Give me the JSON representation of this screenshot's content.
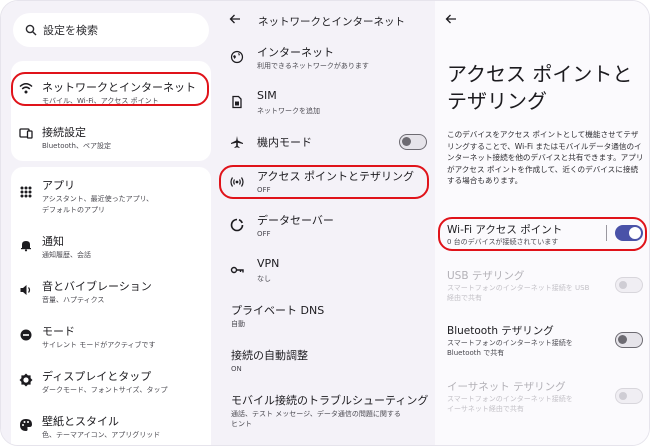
{
  "colors": {
    "highlight": "#e0131a",
    "accent": "#4a52a8"
  },
  "search": {
    "placeholder": "設定を検索"
  },
  "sidebar": {
    "items": [
      {
        "icon": "wifi-icon",
        "title": "ネットワークとインターネット",
        "subtitle": "モバイル、Wi-Fi、アクセス ポイント"
      },
      {
        "icon": "devices-icon",
        "title": "接続設定",
        "subtitle": "Bluetooth、ペア設定"
      },
      {
        "icon": "apps-icon",
        "title": "アプリ",
        "subtitle": "アシスタント、最近使ったアプリ、デフォルトのアプリ"
      },
      {
        "icon": "bell-icon",
        "title": "通知",
        "subtitle": "通知履歴、会話"
      },
      {
        "icon": "volume-icon",
        "title": "音とバイブレーション",
        "subtitle": "音量、ハプティクス"
      },
      {
        "icon": "mode-icon",
        "title": "モード",
        "subtitle": "サイレント モードがアクティブです"
      },
      {
        "icon": "brightness-icon",
        "title": "ディスプレイとタップ",
        "subtitle": "ダークモード、フォントサイズ、タップ"
      },
      {
        "icon": "palette-icon",
        "title": "壁紙とスタイル",
        "subtitle": "色、テーマアイコン、アプリグリッド"
      }
    ]
  },
  "network": {
    "title": "ネットワークとインターネット",
    "items": [
      {
        "icon": "internet-icon",
        "title": "インターネット",
        "subtitle": "利用できるネットワークがあります"
      },
      {
        "icon": "sim-icon",
        "title": "SIM",
        "subtitle": "ネットワークを追加"
      },
      {
        "icon": "airplane-icon",
        "title": "機内モード",
        "subtitle": "",
        "toggle": "off"
      },
      {
        "icon": "hotspot-icon",
        "title": "アクセス ポイントとテザリング",
        "subtitle": "OFF"
      },
      {
        "icon": "data-saver-icon",
        "title": "データセーバー",
        "subtitle": "OFF"
      },
      {
        "icon": "vpn-icon",
        "title": "VPN",
        "subtitle": "なし"
      },
      {
        "icon": "",
        "title": "プライベート DNS",
        "subtitle": "自動"
      },
      {
        "icon": "",
        "title": "接続の自動調整",
        "subtitle": "ON"
      },
      {
        "icon": "",
        "title": "モバイル接続のトラブルシューティング",
        "subtitle_line1": "通話、テスト メッセージ、データ通信の問題に関する",
        "subtitle_line2": "ヒント"
      }
    ]
  },
  "tethering": {
    "title_line1": "アクセス ポイントと",
    "title_line2": "テザリング",
    "description": "このデバイスをアクセス ポイントとして機能させてテザリングすることで、Wi-Fi またはモバイルデータ通信のインターネット接続を他のデバイスと共有できます。アプリがアクセス ポイントを作成して、近くのデバイスに接続する場合もあります。",
    "items": [
      {
        "title": "Wi-Fi アクセス ポイント",
        "subtitle": "0 台のデバイスが接続されています",
        "state": "on"
      },
      {
        "title": "USB テザリング",
        "subtitle_line1": "スマートフォンのインターネット接続を USB",
        "subtitle_line2": "経由で共有",
        "state": "disabled"
      },
      {
        "title": "Bluetooth テザリング",
        "subtitle_line1": "スマートフォンのインターネット接続を",
        "subtitle_line2": "Bluetooth で共有",
        "state": "off"
      },
      {
        "title": "イーサネット テザリング",
        "subtitle_line1": "スマートフォンのインターネット接続を",
        "subtitle_line2": "イーサネット経由で共有",
        "state": "disabled"
      }
    ]
  }
}
